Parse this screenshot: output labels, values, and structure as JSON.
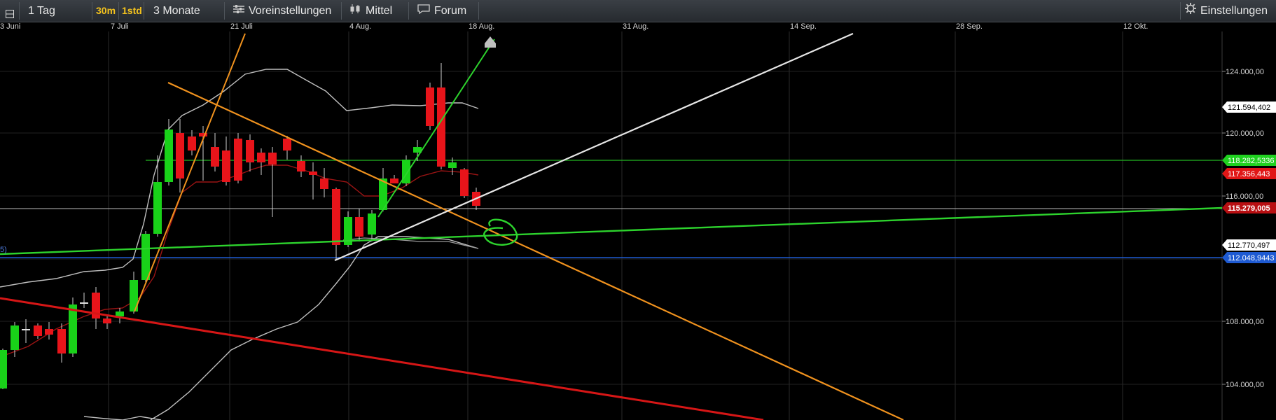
{
  "toolbar": {
    "range": "1 Tag",
    "interval_30m": "30m",
    "interval_1std": "1std",
    "period": "3 Monate",
    "presets": "Voreinstellungen",
    "indicator": "Mittel",
    "forum": "Forum",
    "settings": "Einstellungen"
  },
  "dates": [
    "3 Juni",
    "7 Juli",
    "21 Juli",
    "4 Aug.",
    "18 Aug.",
    "31 Aug.",
    "14 Sep.",
    "28 Sep.",
    "12 Okt."
  ],
  "price_axis": {
    "ticks": [
      "124.000,00",
      "120.000,00",
      "116.000,00",
      "108.000,00",
      "104.000,00"
    ],
    "tags": {
      "high": "121.594,402",
      "green_level": "118.282,5336",
      "red_level": "117.356,443",
      "last": "115.279,005",
      "low": "112.770,497",
      "blue_level": "112.048,9443"
    },
    "left_fragment": "5)"
  },
  "colors": {
    "up": "#19d219",
    "down": "#e8141a",
    "orange": "#f0921e",
    "blue": "#1e5ad2",
    "white_line": "#e6e6e6",
    "red_trend": "#d61616"
  },
  "icons": {
    "presets": "sliders-icon",
    "indicator": "candles-icon",
    "forum": "chat-bubble-icon",
    "settings": "gear-icon",
    "alert": "home-marker-icon"
  }
}
